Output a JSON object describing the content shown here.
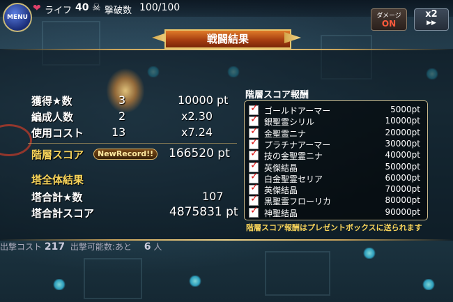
{
  "topbar": {
    "menu_label": "MENU",
    "life_label": "ライフ",
    "life_value": "40",
    "kill_label": "撃破数",
    "kill_value": "100/100",
    "damage_label": "ダメージ",
    "damage_state": "ON",
    "speed_label": "x2",
    "speed_arrows": "▶▶"
  },
  "title": "戦闘結果",
  "results": {
    "stars_label": "獲得★数",
    "stars_count": "3",
    "stars_pts": "10000 pt",
    "members_label": "編成人数",
    "members_count": "2",
    "members_mult": "x2.30",
    "cost_label": "使用コスト",
    "cost_count": "13",
    "cost_mult": "x7.24",
    "floor_score_label": "階層スコア",
    "new_record": "NewRecord!!",
    "floor_score": "166520 pt",
    "tower_header": "塔全体結果",
    "tower_stars_label": "塔合計★数",
    "tower_stars": "107",
    "tower_score_label": "塔合計スコア",
    "tower_score": "4875831 pt"
  },
  "rewards": {
    "title": "階層スコア報酬",
    "items": [
      {
        "name": "ゴールドアーマー",
        "pts": "5000pt"
      },
      {
        "name": "銀聖霊シリル",
        "pts": "10000pt"
      },
      {
        "name": "金聖霊ニナ",
        "pts": "20000pt"
      },
      {
        "name": "プラチナアーマー",
        "pts": "30000pt"
      },
      {
        "name": "技の金聖霊ニナ",
        "pts": "40000pt"
      },
      {
        "name": "英傑結晶",
        "pts": "50000pt"
      },
      {
        "name": "白金聖霊セリア",
        "pts": "60000pt"
      },
      {
        "name": "英傑結晶",
        "pts": "70000pt"
      },
      {
        "name": "黒聖霊フローリカ",
        "pts": "80000pt"
      },
      {
        "name": "神聖結晶",
        "pts": "90000pt"
      }
    ],
    "notice": "階層スコア報酬はプレゼントボックスに送られます"
  },
  "bottom": {
    "cost_label": "出撃コスト",
    "cost_value": "217",
    "remain_label": "出撃可能数:あと",
    "remain_value": "6",
    "remain_unit": "人"
  }
}
